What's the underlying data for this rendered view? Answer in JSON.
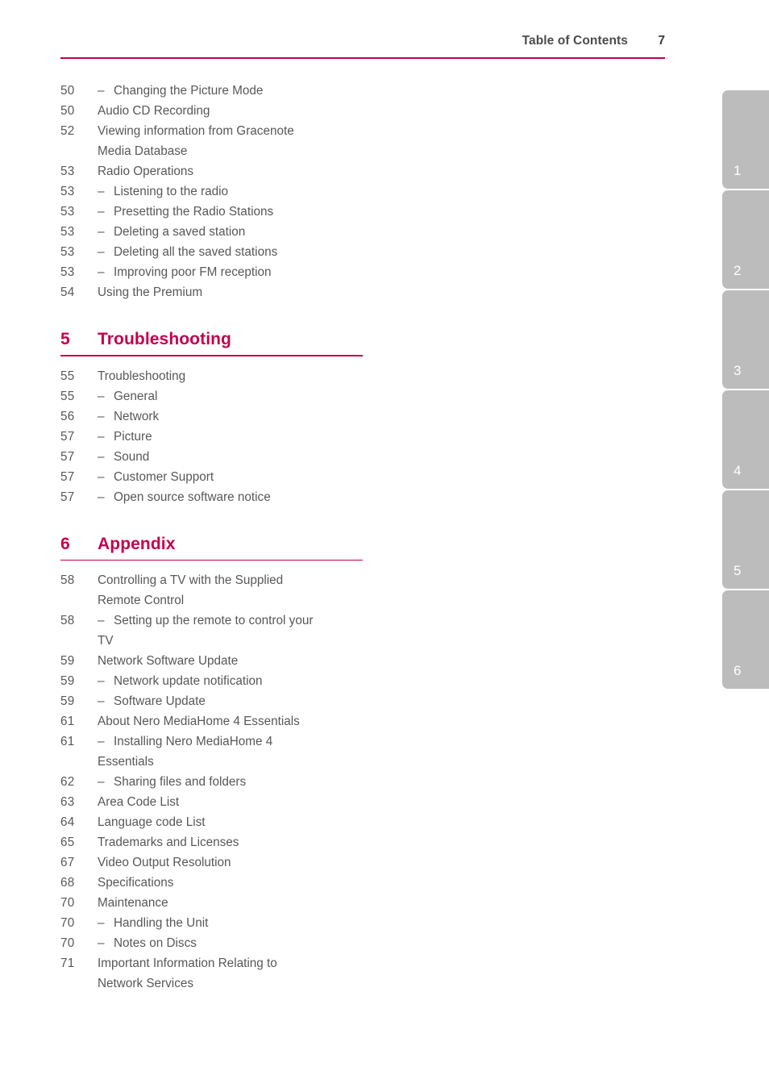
{
  "header": {
    "title": "Table of Contents",
    "page_number": "7",
    "rule_color": "#c4004e"
  },
  "colors": {
    "accent": "#c4004e",
    "body_text": "#58585a",
    "tab_bg": "#bcbcbc",
    "tab_text": "#ffffff"
  },
  "toc": {
    "top_entries": [
      {
        "page": "50",
        "dash": "–",
        "label": "Changing the Picture Mode"
      },
      {
        "page": "50",
        "dash": "",
        "label": "Audio CD Recording"
      },
      {
        "page": "52",
        "dash": "",
        "label": "Viewing information from Gracenote"
      },
      {
        "page": "",
        "dash": "",
        "label": "Media Database"
      },
      {
        "page": "53",
        "dash": "",
        "label": "Radio Operations"
      },
      {
        "page": "53",
        "dash": "–",
        "label": "Listening to the radio"
      },
      {
        "page": "53",
        "dash": "–",
        "label": "Presetting the Radio Stations"
      },
      {
        "page": "53",
        "dash": "–",
        "label": "Deleting a saved station"
      },
      {
        "page": "53",
        "dash": "–",
        "label": "Deleting all the saved stations"
      },
      {
        "page": "53",
        "dash": "–",
        "label": "Improving poor FM reception"
      },
      {
        "page": "54",
        "dash": "",
        "label": "Using the Premium"
      }
    ],
    "sections": [
      {
        "number": "5",
        "title": "Troubleshooting",
        "entries": [
          {
            "page": "55",
            "dash": "",
            "label": "Troubleshooting"
          },
          {
            "page": "55",
            "dash": "–",
            "label": "General"
          },
          {
            "page": "56",
            "dash": "–",
            "label": "Network"
          },
          {
            "page": "57",
            "dash": "–",
            "label": "Picture"
          },
          {
            "page": "57",
            "dash": "–",
            "label": "Sound"
          },
          {
            "page": "57",
            "dash": "–",
            "label": "Customer Support"
          },
          {
            "page": "57",
            "dash": "–",
            "label": "Open source software notice"
          }
        ]
      },
      {
        "number": "6",
        "title": "Appendix",
        "entries": [
          {
            "page": "58",
            "dash": "",
            "label": "Controlling a TV with the Supplied"
          },
          {
            "page": "",
            "dash": "",
            "label": "Remote Control"
          },
          {
            "page": "58",
            "dash": "–",
            "label": "Setting up the remote to control your"
          },
          {
            "page": "",
            "dash": "",
            "label": "TV"
          },
          {
            "page": "59",
            "dash": "",
            "label": "Network Software Update"
          },
          {
            "page": "59",
            "dash": "–",
            "label": "Network update notification"
          },
          {
            "page": "59",
            "dash": "–",
            "label": "Software Update"
          },
          {
            "page": "61",
            "dash": "",
            "label": "About Nero MediaHome 4 Essentials"
          },
          {
            "page": "61",
            "dash": "–",
            "label": "Installing Nero MediaHome 4"
          },
          {
            "page": "",
            "dash": "",
            "label": "Essentials"
          },
          {
            "page": "62",
            "dash": "–",
            "label": "Sharing files and folders"
          },
          {
            "page": "63",
            "dash": "",
            "label": "Area Code List"
          },
          {
            "page": "64",
            "dash": "",
            "label": "Language code List"
          },
          {
            "page": "65",
            "dash": "",
            "label": "Trademarks and Licenses"
          },
          {
            "page": "67",
            "dash": "",
            "label": "Video Output Resolution"
          },
          {
            "page": "68",
            "dash": "",
            "label": "Specifications"
          },
          {
            "page": "70",
            "dash": "",
            "label": "Maintenance"
          },
          {
            "page": "70",
            "dash": "–",
            "label": "Handling the Unit"
          },
          {
            "page": "70",
            "dash": "–",
            "label": "Notes on Discs"
          },
          {
            "page": "71",
            "dash": "",
            "label": "Important Information Relating to"
          },
          {
            "page": "",
            "dash": "",
            "label": "Network Services"
          }
        ]
      }
    ]
  },
  "side_tabs": [
    {
      "label": "1"
    },
    {
      "label": "2"
    },
    {
      "label": "3"
    },
    {
      "label": "4"
    },
    {
      "label": "5"
    },
    {
      "label": "6"
    }
  ]
}
